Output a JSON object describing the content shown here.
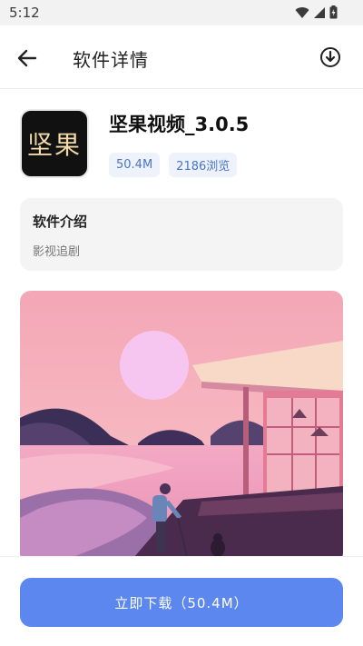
{
  "status_bar": {
    "time": "5:12",
    "icons": [
      "wifi-icon",
      "signal-icon",
      "battery-icon"
    ]
  },
  "app_bar": {
    "title": "软件详情",
    "back_icon": "arrow-left-icon",
    "action_icon": "download-circle-icon"
  },
  "app": {
    "icon_text": "坚果",
    "name": "坚果视频_3.0.5",
    "size": "50.4M",
    "views": "2186浏览"
  },
  "intro": {
    "title": "软件介绍",
    "description": "影视追剧"
  },
  "download": {
    "label": "立即下载（50.4M）"
  },
  "colors": {
    "accent": "#5b87ef",
    "chip_text": "#4a74c9",
    "chip_bg": "#eef2fa"
  }
}
